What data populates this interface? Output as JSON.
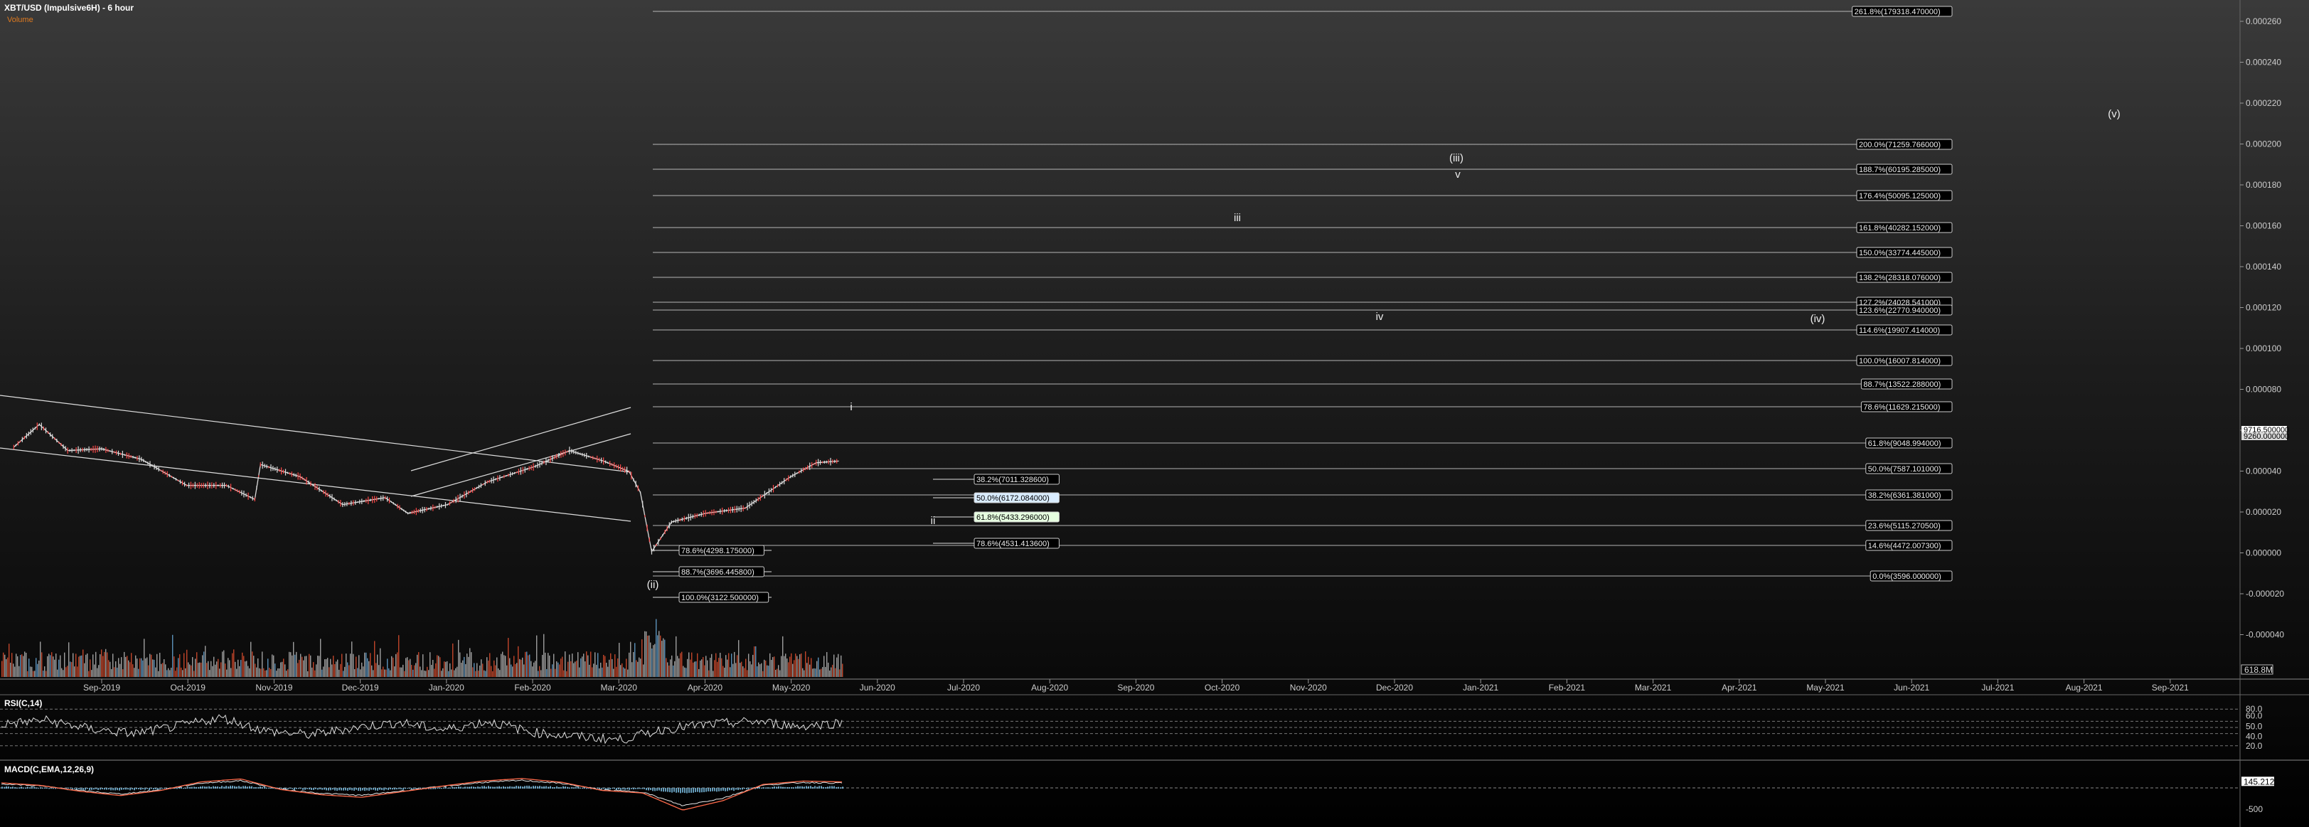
{
  "header": {
    "title": "XBT/USD (Impulsive6H) - 6 hour",
    "subtitle": "Volume"
  },
  "colors": {
    "background_top": "#3a3a3a",
    "background_bottom": "#000000",
    "grid_line": "#cfcfcf",
    "fib_label_fill": "#000000",
    "fib_label_highlight": "#d9ecff",
    "fib_label_highlight2": "#e6ffe0",
    "price_up": "#dcdcdc",
    "price_down": "#ff4a4a",
    "volume_up": "#b8b8b8",
    "volume_down": "#e05030",
    "volume_highlight": "#6aa9d8",
    "macd_line": "#ff6a4a",
    "macd_signal": "#e8e8e8",
    "macd_hist": "#7ec3e8"
  },
  "chart_data": {
    "type": "line",
    "title": "XBT/USD (Impulsive6H) - 6 hour",
    "x_axis_labels": [
      "Sep-2019",
      "Oct-2019",
      "Nov-2019",
      "Dec-2019",
      "Jan-2020",
      "Feb-2020",
      "Mar-2020",
      "Apr-2020",
      "May-2020",
      "Jun-2020",
      "Jul-2020",
      "Aug-2020",
      "Sep-2020",
      "Oct-2020",
      "Nov-2020",
      "Dec-2020",
      "Jan-2021",
      "Feb-2021",
      "Mar-2021",
      "Apr-2021",
      "May-2021",
      "Jun-2021",
      "Jul-2021",
      "Aug-2021",
      "Sep-2021"
    ],
    "y_axis_labels": [
      "0.000260",
      "0.000240",
      "0.000220",
      "0.000200",
      "0.000180",
      "0.000160",
      "0.000140",
      "0.000120",
      "0.000100",
      "0.000080",
      "0.000060",
      "0.000040",
      "0.000020",
      "0.000000",
      "-0.000020",
      "-0.000040"
    ],
    "y_axis_values": [
      0.00026,
      0.00024,
      0.00022,
      0.0002,
      0.00018,
      0.00016,
      0.00014,
      0.00012,
      0.0001,
      8e-05,
      6e-05,
      4e-05,
      2e-05,
      0,
      -2e-05,
      -4e-05
    ],
    "last_price_labels": [
      "9716.500000",
      "9260.000000"
    ],
    "volume_axis_label": "618.8M",
    "price_series": {
      "name": "XBT/USD",
      "x": [
        "2019-08-01",
        "2019-08-10",
        "2019-08-20",
        "2019-09-01",
        "2019-09-15",
        "2019-10-01",
        "2019-10-15",
        "2019-10-25",
        "2019-10-27",
        "2019-11-10",
        "2019-11-25",
        "2019-12-10",
        "2019-12-18",
        "2020-01-01",
        "2020-01-15",
        "2020-02-01",
        "2020-02-13",
        "2020-02-25",
        "2020-03-05",
        "2020-03-09",
        "2020-03-13",
        "2020-03-20",
        "2020-04-01",
        "2020-04-15",
        "2020-05-01",
        "2020-05-10",
        "2020-05-18"
      ],
      "y": [
        10500,
        11800,
        10300,
        10400,
        9800,
        8300,
        8300,
        7500,
        9500,
        8800,
        7200,
        7600,
        6700,
        7200,
        8500,
        9400,
        10300,
        9700,
        9100,
        7900,
        4500,
        6200,
        6700,
        7000,
        8800,
        9600,
        9700
      ]
    },
    "fib_extension_levels": [
      {
        "label": "261.8%(179318.470000)"
      },
      {
        "label": "200.0%(71259.766000)"
      },
      {
        "label": "188.7%(60195.285000)"
      },
      {
        "label": "176.4%(50095.125000)"
      },
      {
        "label": "161.8%(40282.152000)"
      },
      {
        "label": "150.0%(33774.445000)"
      },
      {
        "label": "138.2%(28318.076000)"
      },
      {
        "label": "127.2%(24028.541000)"
      },
      {
        "label": "123.6%(22770.940000)"
      },
      {
        "label": "114.6%(19907.414000)"
      },
      {
        "label": "100.0%(16007.814000)"
      },
      {
        "label": "88.7%(13522.288000)"
      },
      {
        "label": "78.6%(11629.215000)"
      },
      {
        "label": "61.8%(9048.994000)"
      },
      {
        "label": "50.0%(7587.101000)"
      },
      {
        "label": "38.2%(6361.381000)"
      },
      {
        "label": "23.6%(5115.270500)"
      },
      {
        "label": "14.6%(4472.007300)"
      },
      {
        "label": "0.0%(3596.000000)"
      }
    ],
    "fib_retracement_upper": [
      {
        "label": "38.2%(7011.328600)"
      },
      {
        "label": "50.0%(6172.084000)"
      },
      {
        "label": "61.8%(5433.296000)"
      },
      {
        "label": "78.6%(4531.413600)"
      }
    ],
    "fib_retracement_lower": [
      {
        "label": "78.6%(4298.175000)"
      },
      {
        "label": "88.7%(3696.445800)"
      },
      {
        "label": "100.0%(3122.500000)"
      }
    ],
    "wave_labels": [
      {
        "text": "i"
      },
      {
        "text": "ii"
      },
      {
        "text": "iii"
      },
      {
        "text": "iv"
      },
      {
        "text": "v"
      },
      {
        "text": "(ii)"
      },
      {
        "text": "(iii)"
      },
      {
        "text": "(iv)"
      },
      {
        "text": "(v)"
      }
    ],
    "rsi": {
      "name": "RSI(C,14)",
      "axis_labels": [
        "80.0",
        "50.0",
        "60.0",
        "40.0",
        "20.0"
      ],
      "values": [
        55,
        62,
        48,
        40,
        52,
        66,
        44,
        38,
        50,
        58,
        46,
        60,
        42,
        35,
        30,
        48,
        55,
        60,
        52,
        58
      ]
    },
    "macd": {
      "name": "MACD(C,EMA,12,26,9)",
      "axis_labels": [
        "145.212",
        "-500"
      ],
      "values": [
        120,
        60,
        -80,
        -180,
        -60,
        140,
        210,
        -40,
        -160,
        -220,
        -90,
        40,
        160,
        220,
        130,
        -60,
        -120,
        -520,
        -300,
        80,
        160,
        140
      ]
    }
  }
}
